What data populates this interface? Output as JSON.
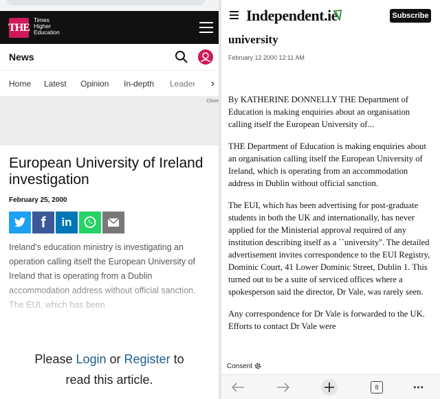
{
  "left": {
    "the_logo": "THE",
    "the_words": [
      "Times",
      "Higher",
      "Education"
    ],
    "section_title": "News",
    "nav": [
      "Home",
      "Latest",
      "Opinion",
      "In-depth",
      "Leader"
    ],
    "nav_arrow": "›",
    "ad_close": "Close",
    "headline": "European University of Ireland investigation",
    "date": "February 25, 2000",
    "share": [
      {
        "name": "twitter",
        "color": "#1da1f2",
        "glyph": "t"
      },
      {
        "name": "facebook",
        "color": "#3b5998",
        "glyph": "f"
      },
      {
        "name": "linkedin",
        "color": "#0077b5",
        "glyph": "in"
      },
      {
        "name": "whatsapp",
        "color": "#25d366",
        "glyph": "✆"
      },
      {
        "name": "email",
        "color": "#777777",
        "glyph": "✉"
      }
    ],
    "lede": "Ireland's education ministry is investigating an operation calling itself the European University of Ireland that is operating from a Dublin accommodation address without official sanction. The EUI, which has been",
    "cta_please": "Please ",
    "cta_login": "Login",
    "cta_or": " or ",
    "cta_register": "Register",
    "cta_to": " to",
    "cta_line2": "read this article."
  },
  "right": {
    "logo": "Independent.ie",
    "subscribe": "Subscribe",
    "title_fragment": "university",
    "date": "February 12 2000 12:11 AM",
    "paragraphs": [
      "By KATHERINE DONNELLY THE Department of Education is making enquiries about an organisation calling itself the European University of...",
      "THE Department of Education is making enquiries about an organisation calling itself the European University of Ireland, which is operating from an accommodation address in Dublin without official sanction.",
      "The EUI, which has been advertising for post-graduate students in both the UK and internationally, has never applied for the Ministerial approval required of any institution describing itself as a ``university''. The detailed advertisement invites correspondence to the EUI Registry, Dominic Court, 41 Lower Dominic Street, Dublin 1. This turned out to be a suite of serviced offices where a spokesperson said the director, Dr Vale, was rarely seen.",
      "Any correspondence for Dr Vale is forwarded to the UK. Efforts to contact Dr Vale were"
    ],
    "consent": "Consent",
    "tab_count": "8",
    "nav_more": "•••"
  },
  "colors": {
    "the_pink": "#d1185b",
    "link_blue": "#1c5d8c",
    "ind_green": "#2a8a3e"
  }
}
